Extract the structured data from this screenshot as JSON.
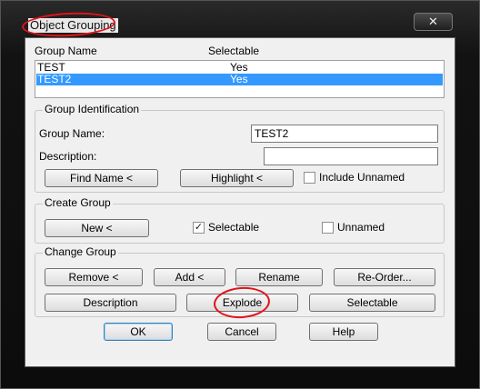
{
  "window": {
    "title": "Object Grouping",
    "close_glyph": "✕"
  },
  "list": {
    "headers": [
      "Group Name",
      "Selectable"
    ],
    "rows": [
      {
        "name": "TEST",
        "selectable": "Yes",
        "selected": false
      },
      {
        "name": "TEST2",
        "selectable": "Yes",
        "selected": true
      }
    ]
  },
  "identification": {
    "legend": "Group Identification",
    "group_name_label": "Group Name:",
    "group_name_value": "TEST2",
    "description_label": "Description:",
    "description_value": "",
    "find_name_label": "Find Name <",
    "highlight_label": "Highlight <",
    "include_unnamed_label": "Include Unnamed",
    "include_unnamed_checked": false
  },
  "create": {
    "legend": "Create Group",
    "new_label": "New <",
    "selectable_label": "Selectable",
    "selectable_checked": true,
    "unnamed_label": "Unnamed",
    "unnamed_checked": false
  },
  "change": {
    "legend": "Change Group",
    "remove_label": "Remove <",
    "add_label": "Add <",
    "rename_label": "Rename",
    "reorder_label": "Re-Order...",
    "description_label": "Description",
    "explode_label": "Explode",
    "selectable_label": "Selectable"
  },
  "footer": {
    "ok_label": "OK",
    "cancel_label": "Cancel",
    "help_label": "Help"
  },
  "icons": {
    "check_glyph": "✓"
  },
  "annotations": {
    "color": "#e0141a"
  }
}
